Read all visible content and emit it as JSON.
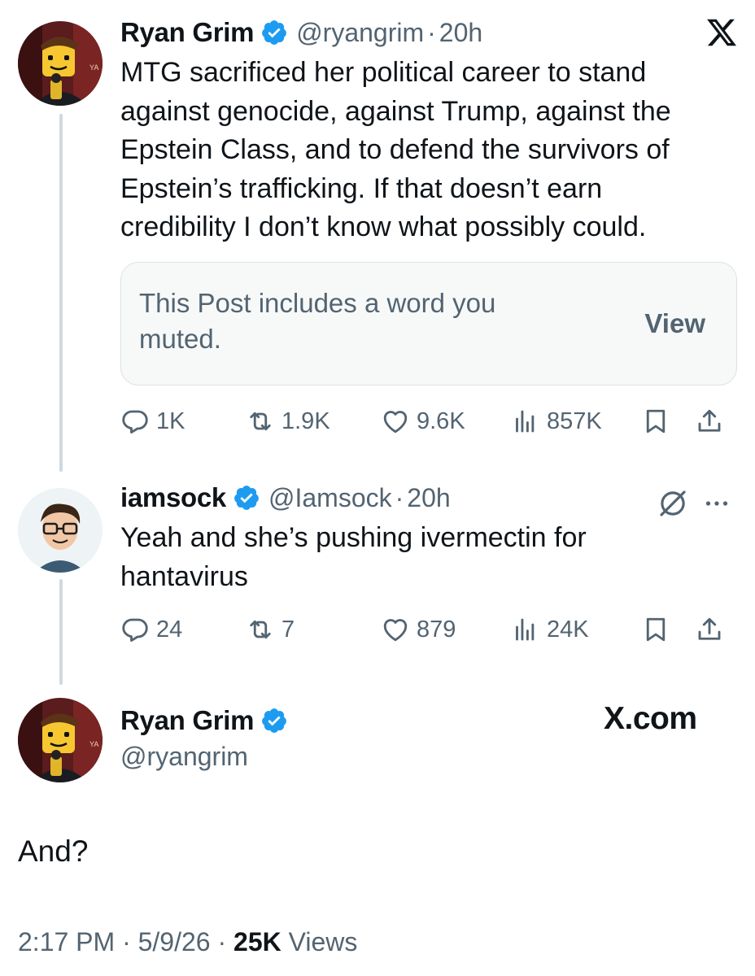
{
  "post": {
    "author_name": "Ryan Grim",
    "handle": "@ryangrim",
    "time": "20h",
    "text": "MTG sacrificed her political career to stand\nagainst genocide, against Trump, against the\nEpstein Class, and to defend the survivors of\nEpstein’s trafficking. If that doesn’t earn\ncredibility I don’t know what possibly could.",
    "muted_notice": "This Post includes a word you\nmuted.",
    "muted_view_label": "View",
    "stats": {
      "replies": "1K",
      "reposts": "1.9K",
      "likes": "9.6K",
      "views": "857K"
    }
  },
  "reply": {
    "author_name": "iamsock",
    "handle": "@Iamsock",
    "time": "20h",
    "text": "Yeah and she’s pushing ivermectin for\nhantavirus",
    "stats": {
      "replies": "24",
      "reposts": "7",
      "likes": "879",
      "views": "24K"
    }
  },
  "quote": {
    "author_name": "Ryan Grim",
    "handle": "@ryangrim",
    "brand": "X.com",
    "text": "And?",
    "footer": {
      "time": "2:17 PM",
      "date": "5/9/26",
      "views_count": "25K",
      "views_label": "Views"
    }
  },
  "icons": {
    "verified": "verified-badge-icon",
    "brand_logo": "x-logo-icon",
    "grok": "grok-icon",
    "more": "more-icon"
  },
  "colors": {
    "verified": "#1d9bf0",
    "secondary_text": "#536471",
    "primary_text": "#0f1419",
    "thread_line": "#cfd9de"
  }
}
